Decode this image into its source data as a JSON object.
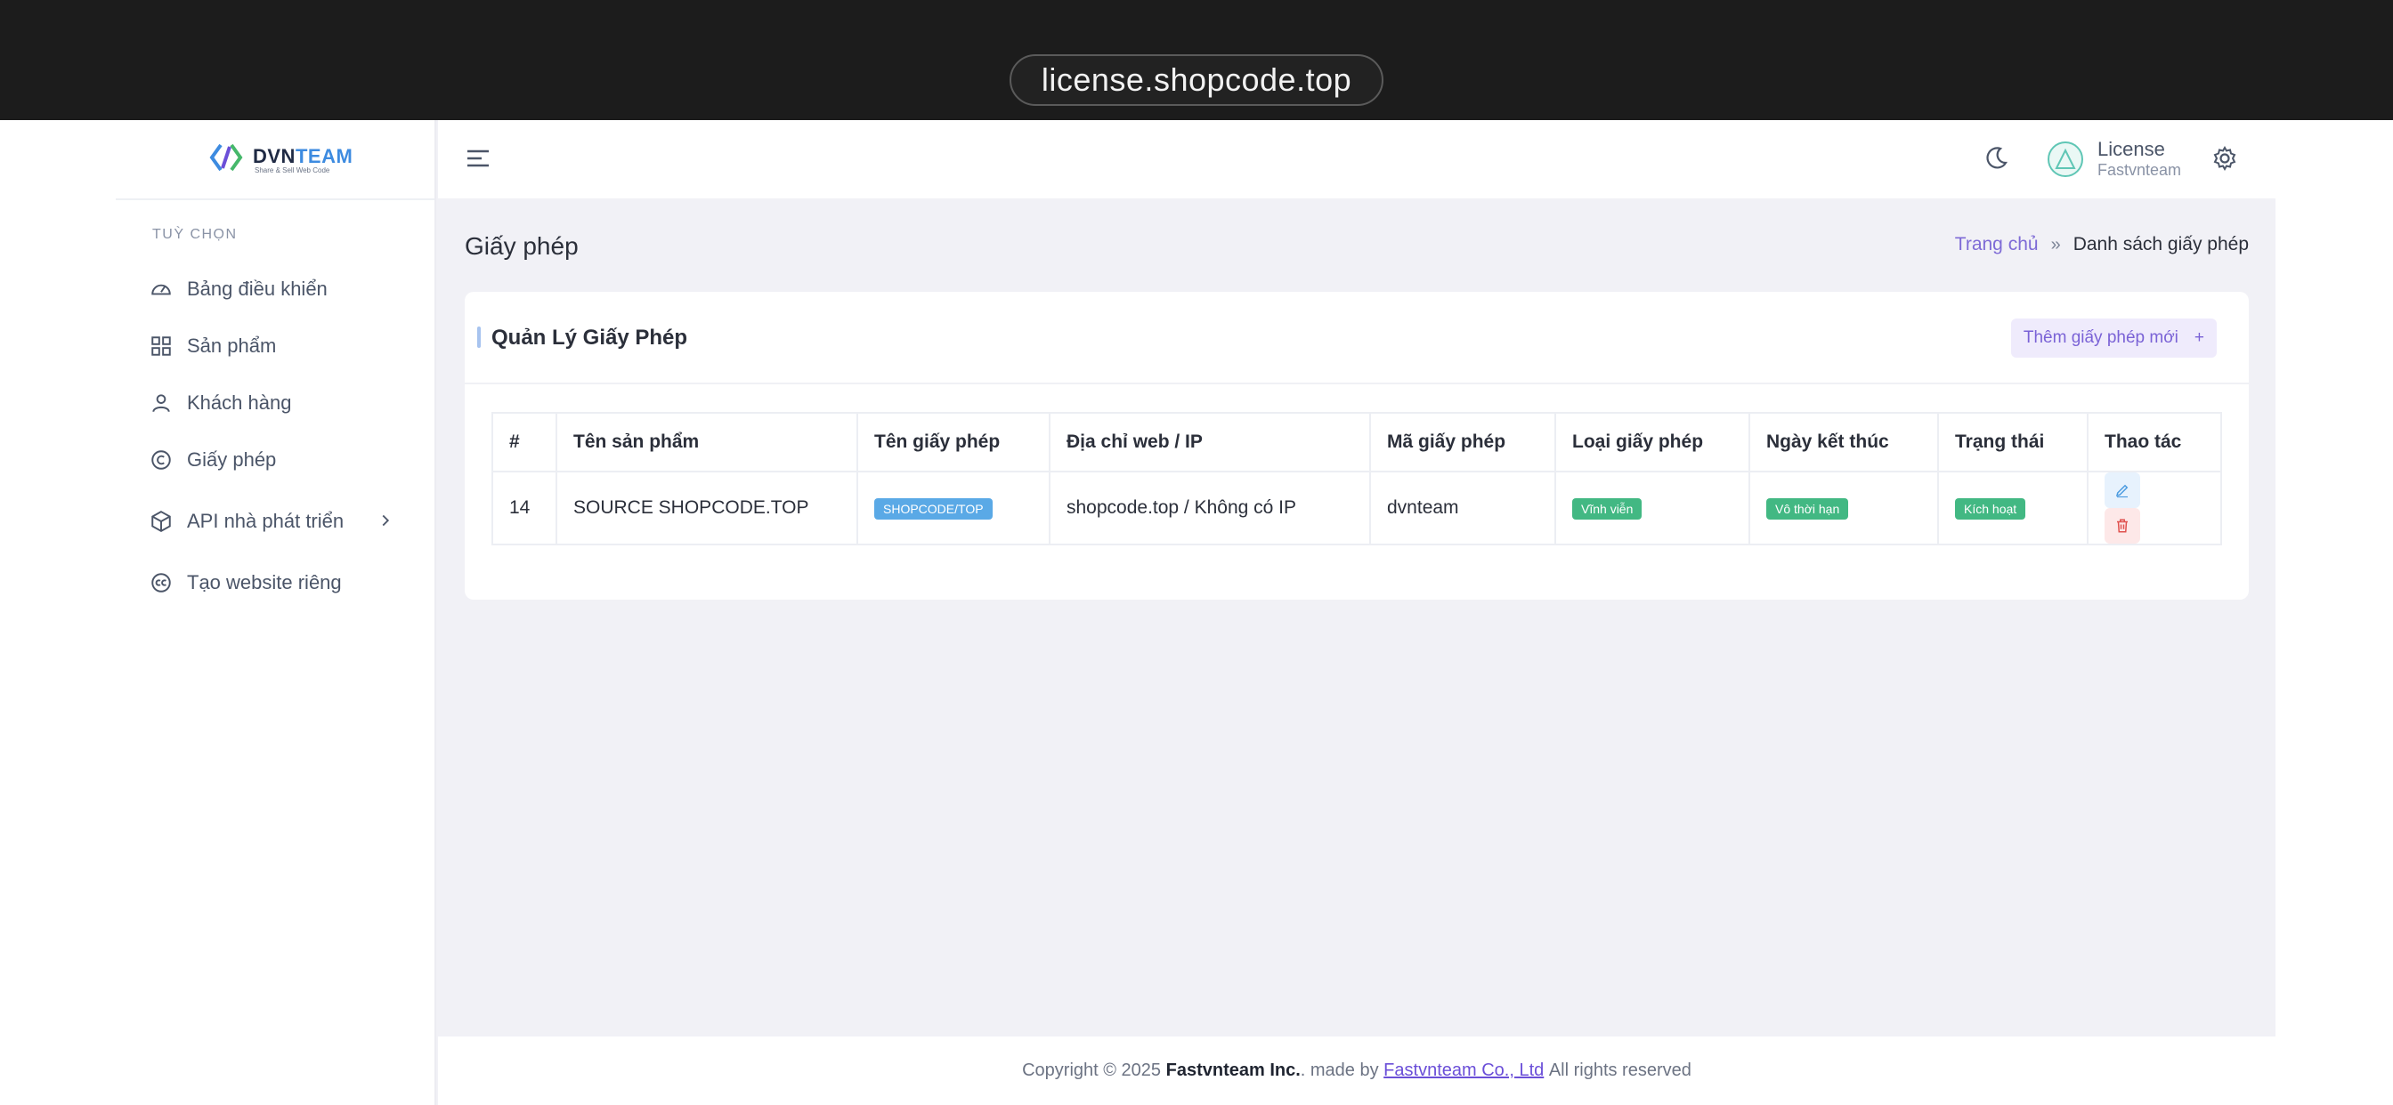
{
  "browser": {
    "url": "license.shopcode.top"
  },
  "brand": {
    "name_a": "DVN",
    "name_b": "TEAM",
    "tagline": "Share & Sell Web Code"
  },
  "sidebar": {
    "section": "TUỲ CHỌN",
    "items": [
      {
        "label": "Bảng điều khiển",
        "icon": "dashboard-icon"
      },
      {
        "label": "Sản phẩm",
        "icon": "grid-icon"
      },
      {
        "label": "Khách hàng",
        "icon": "user-icon"
      },
      {
        "label": "Giấy phép",
        "icon": "copyright-icon"
      },
      {
        "label": "API nhà phát triển",
        "icon": "cube-icon"
      },
      {
        "label": "Tạo website riêng",
        "icon": "cc-icon"
      }
    ]
  },
  "header": {
    "user_name": "License",
    "user_sub": "Fastvnteam"
  },
  "page": {
    "title": "Giấy phép"
  },
  "breadcrumb": {
    "home": "Trang chủ",
    "separator": "»",
    "current": "Danh sách giấy phép"
  },
  "card": {
    "title": "Quản Lý Giấy Phép",
    "add_label": "Thêm giấy phép mới",
    "add_icon": "+"
  },
  "table": {
    "columns": [
      "#",
      "Tên sản phẩm",
      "Tên giấy phép",
      "Địa chỉ web / IP",
      "Mã giấy phép",
      "Loại giấy phép",
      "Ngày kết thúc",
      "Trạng thái",
      "Thao tác"
    ],
    "rows": [
      {
        "id": "14",
        "product": "SOURCE SHOPCODE.TOP",
        "license_name": "SHOPCODE/TOP",
        "web_ip": "shopcode.top / Không có IP",
        "license_code": "dvnteam",
        "license_type": "Vĩnh viễn",
        "end_date": "Vô thời hạn",
        "status": "Kích hoạt"
      }
    ]
  },
  "footer": {
    "prefix": "Copyright © 2025",
    "company": "Fastvnteam Inc.",
    "made_by": ". made by",
    "link": "Fastvnteam Co., Ltd",
    "suffix": "All rights reserved"
  },
  "colors": {
    "accent": "#7a62d6",
    "badge_blue": "#5aa9e6",
    "badge_green": "#42b883"
  }
}
